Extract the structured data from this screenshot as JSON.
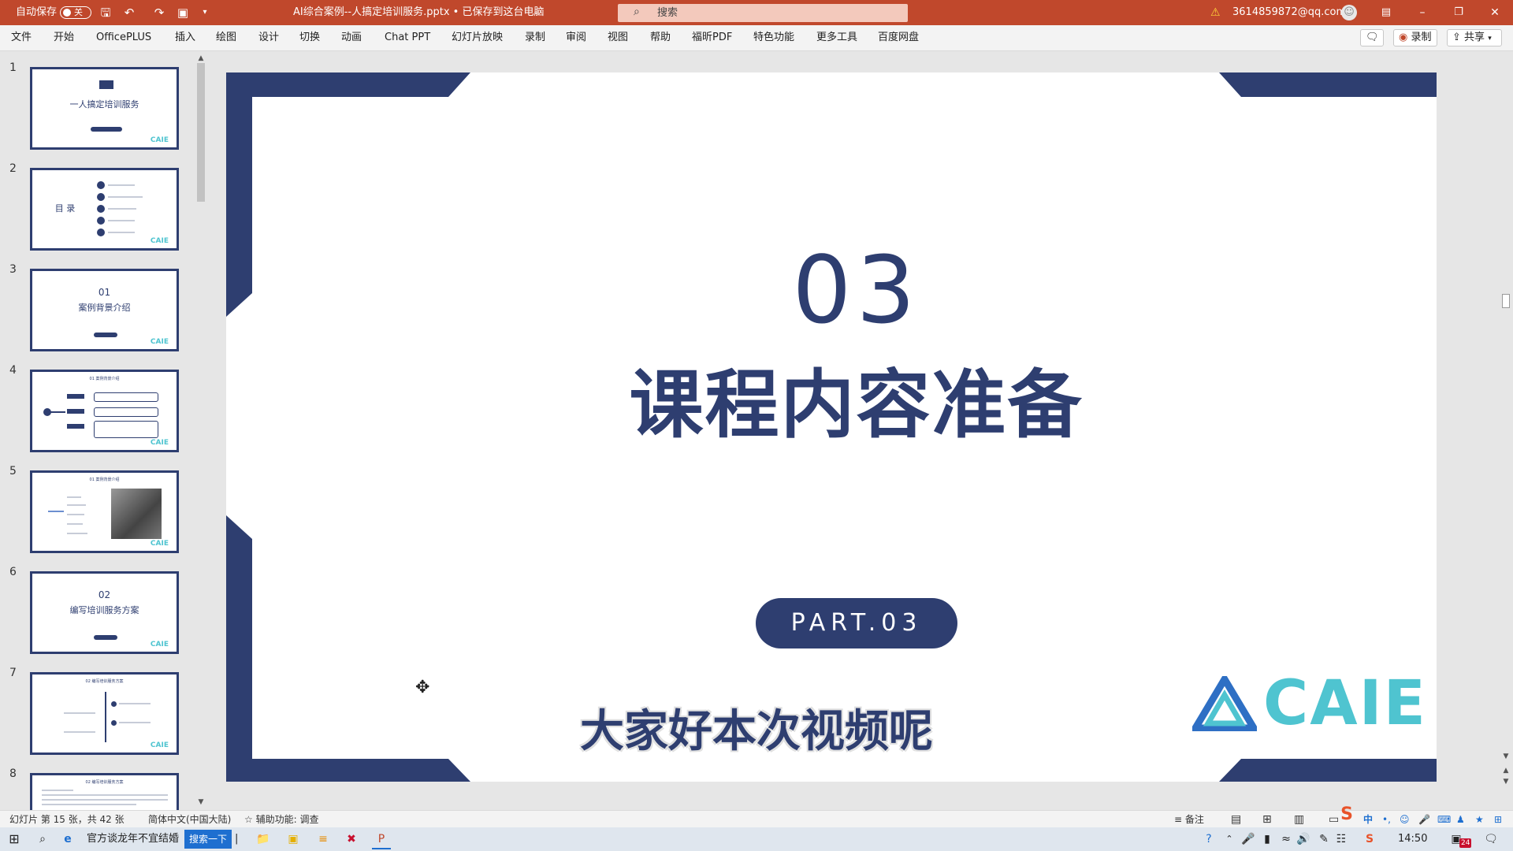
{
  "titlebar": {
    "autosave_label": "自动保存",
    "autosave_state": "关",
    "doc_title": "AI综合案例--人搞定培训服务.pptx • 已保存到这台电脑",
    "search_placeholder": "搜索",
    "account": "3614859872@qq.com"
  },
  "ribbon": {
    "tabs": [
      "文件",
      "开始",
      "OfficePLUS",
      "插入",
      "绘图",
      "设计",
      "切换",
      "动画",
      "Chat PPT",
      "幻灯片放映",
      "录制",
      "审阅",
      "视图",
      "帮助",
      "福昕PDF",
      "特色功能",
      "更多工具",
      "百度网盘"
    ],
    "record_label": "录制",
    "share_label": "共享"
  },
  "thumbnails": [
    {
      "num": "1",
      "title": "一人搞定培训服务"
    },
    {
      "num": "2",
      "title": "目 录"
    },
    {
      "num": "3",
      "num_text": "01",
      "title": "案例背景介绍"
    },
    {
      "num": "4",
      "title": "01 案例背景介绍"
    },
    {
      "num": "5",
      "title": "01 案例背景介绍"
    },
    {
      "num": "6",
      "num_text": "02",
      "title": "编写培训服务方案"
    },
    {
      "num": "7",
      "title": "02 编写培训服务方案"
    },
    {
      "num": "8",
      "title": "02 编写培训服务方案"
    }
  ],
  "thumb_logo": "CAIE",
  "slide": {
    "number_text": "03",
    "title": "课程内容准备",
    "part_label": "PART.03",
    "logo_text": "CAIE"
  },
  "subtitle": "大家好本次视频呢",
  "status": {
    "slide_info": "幻灯片 第 15 张，共 42 张",
    "language": "简体中文(中国大陆)",
    "accessibility": "辅助功能: 调查",
    "notes": "备注"
  },
  "taskbar": {
    "news": "官方谈龙年不宜结婚",
    "search_btn": "搜索一下",
    "clock": "14:50",
    "notif_count": "24"
  },
  "colors": {
    "titlebar": "#c0482c",
    "slide_navy": "#2e3e70",
    "logo_cyan": "#4fc4d0"
  }
}
